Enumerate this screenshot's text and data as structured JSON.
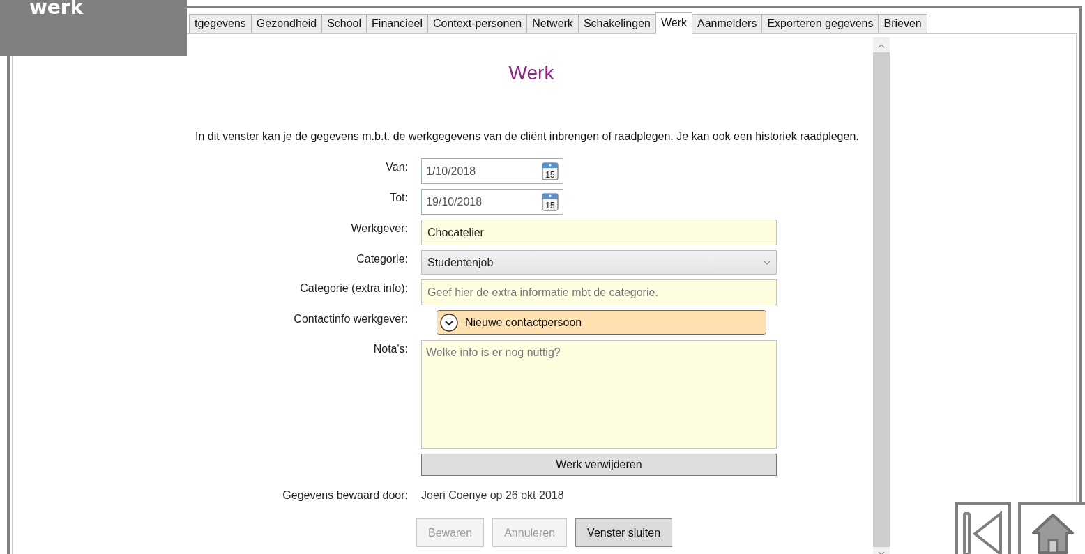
{
  "corner_label": "werk",
  "tabs": [
    {
      "label": "tgegevens",
      "selected": false
    },
    {
      "label": "Gezondheid",
      "selected": false
    },
    {
      "label": "School",
      "selected": false
    },
    {
      "label": "Financieel",
      "selected": false
    },
    {
      "label": "Context-personen",
      "selected": false
    },
    {
      "label": "Netwerk",
      "selected": false
    },
    {
      "label": "Schakelingen",
      "selected": false
    },
    {
      "label": "Werk",
      "selected": true
    },
    {
      "label": "Aanmelders",
      "selected": false
    },
    {
      "label": "Exporteren gegevens",
      "selected": false
    },
    {
      "label": "Brieven",
      "selected": false
    }
  ],
  "title": "Werk",
  "description": "In dit venster kan je de gegevens m.b.t. de werkgegevens van de cliënt inbrengen of raadplegen. Je kan ook een historiek raadplegen.",
  "fields": [
    {
      "kind": "date",
      "label": "Van:",
      "value": "1/10/2018",
      "icon_text": "15"
    },
    {
      "kind": "date",
      "label": "Tot:",
      "value": "19/10/2018",
      "icon_text": "15"
    },
    {
      "kind": "text",
      "label": "Werkgever:",
      "value": "Chocatelier"
    },
    {
      "kind": "select",
      "label": "Categorie:",
      "value": "Studentenjob"
    },
    {
      "kind": "text",
      "label": "Categorie (extra info):",
      "placeholder": "Geef hier de extra informatie mbt de categorie."
    },
    {
      "kind": "expander",
      "label": "Contactinfo werkgever:",
      "button": "Nieuwe contactpersoon",
      "expanded": false
    },
    {
      "kind": "textarea",
      "label": "Nota's:",
      "placeholder": "Welke info is er nog nuttig?"
    }
  ],
  "delete_button": "Werk verwijderen",
  "saved_by": {
    "label": "Gegevens bewaard door:",
    "value": "Joeri Coenye op 26 okt 2018"
  },
  "buttons": [
    {
      "label": "Bewaren",
      "disabled": true
    },
    {
      "label": "Annuleren",
      "disabled": true
    },
    {
      "label": "Venster sluiten",
      "disabled": false
    }
  ]
}
